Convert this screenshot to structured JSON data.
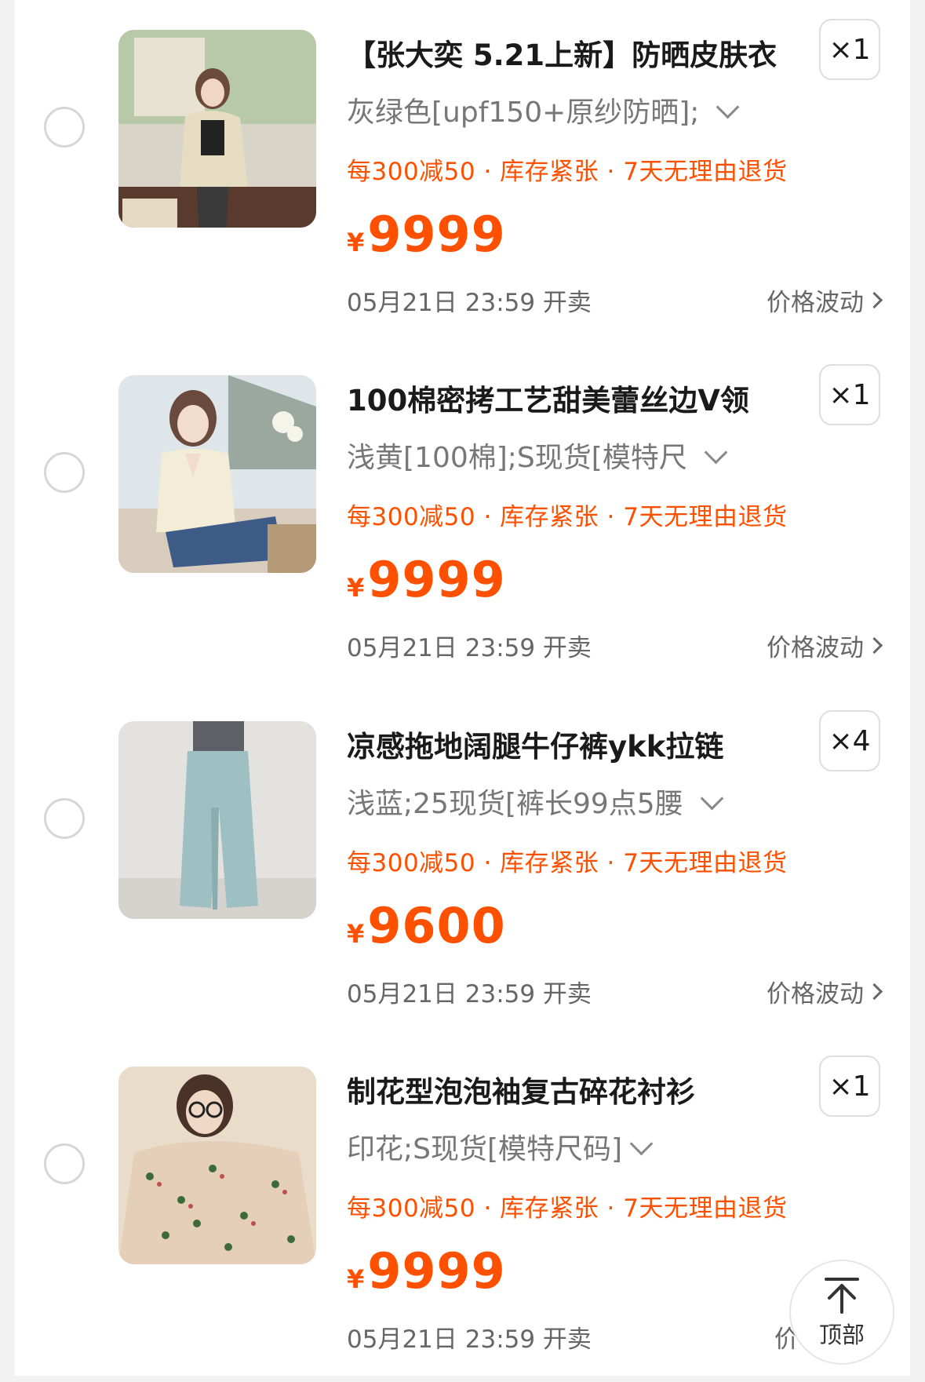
{
  "items": [
    {
      "title": "【张大奕 5.21上新】防晒皮肤衣",
      "qty": "×1",
      "sku": "灰绿色[upf150+原纱防晒];",
      "promo": "每300减50 · 库存紧张 · 7天无理由退货",
      "currency": "¥",
      "price": "9999",
      "sale_time": "05月21日 23:59 开卖",
      "price_note": "价格波动",
      "image": "woman-in-light-jacket-photo"
    },
    {
      "title": "100棉密拷工艺甜美蕾丝边V领",
      "qty": "×1",
      "sku": "浅黄[100棉];S现货[模特尺",
      "promo": "每300减50 · 库存紧张 · 7天无理由退货",
      "currency": "¥",
      "price": "9999",
      "sale_time": "05月21日 23:59 开卖",
      "price_note": "价格波动",
      "image": "woman-in-cream-v-neck-top-photo"
    },
    {
      "title": "凉感拖地阔腿牛仔裤ykk拉链",
      "qty": "×4",
      "sku": "浅蓝;25现货[裤长99点5腰",
      "promo": "每300减50 · 库存紧张 · 7天无理由退货",
      "currency": "¥",
      "price": "9600",
      "sale_time": "05月21日 23:59 开卖",
      "price_note": "价格波动",
      "image": "wide-leg-jeans-photo"
    },
    {
      "title": "制花型泡泡袖复古碎花衬衫",
      "qty": "×1",
      "sku": "印花;S现货[模特尺码]",
      "promo": "每300减50 · 库存紧张 · 7天无理由退货",
      "currency": "¥",
      "price": "9999",
      "sale_time": "05月21日 23:59 开卖",
      "price_note": "价",
      "image": "woman-in-floral-blouse-photo"
    }
  ],
  "back_to_top": {
    "label": "顶部",
    "icon": "arrow-up-bar-icon"
  },
  "colors": {
    "accent": "#ff5000",
    "background": "#f2f2f2",
    "card": "#ffffff"
  }
}
